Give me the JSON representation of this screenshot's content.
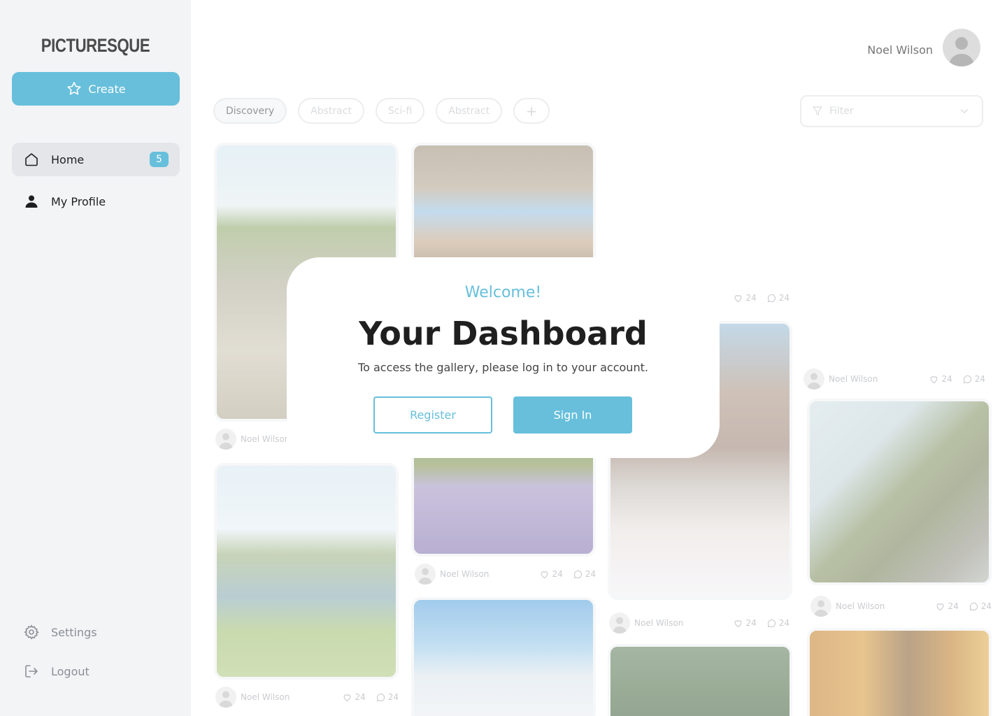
{
  "app": {
    "logo": "PICTURESQUE",
    "create_label": "Create"
  },
  "sidebar": {
    "items": [
      {
        "label": "Home",
        "badge": "5"
      },
      {
        "label": "My Profile"
      }
    ],
    "bottom": [
      {
        "label": "Settings"
      },
      {
        "label": "Logout"
      }
    ]
  },
  "header": {
    "user_name": "Noel Wilson"
  },
  "tags": [
    "Discovery",
    "Abstract",
    "Sci-fi",
    "Abstract"
  ],
  "tag_add": "+",
  "filter": {
    "placeholder": "Filter"
  },
  "posts": [
    {
      "author": "Noel Wilson",
      "likes": "24",
      "comments": "24"
    },
    {
      "author": "Noel Wilson",
      "likes": "24",
      "comments": "24"
    },
    {
      "author": "Noel Wilson",
      "likes": "24",
      "comments": "24"
    },
    {
      "author": "Noel Wilson",
      "likes": "24",
      "comments": "24"
    },
    {
      "author": "Noel Wilson",
      "likes": "24",
      "comments": "24"
    },
    {
      "author": "Noel Wilson",
      "likes": "24",
      "comments": "24"
    }
  ],
  "post_stats_partial": {
    "likes": "24",
    "comments": "24"
  },
  "modal": {
    "welcome": "Welcome!",
    "title": "Your Dashboard",
    "subtitle": "To access the gallery, please log in to your account.",
    "register": "Register",
    "sign_in": "Sign In"
  },
  "colors": {
    "accent": "#67bfdb",
    "sidebar_bg": "#f3f4f6"
  }
}
